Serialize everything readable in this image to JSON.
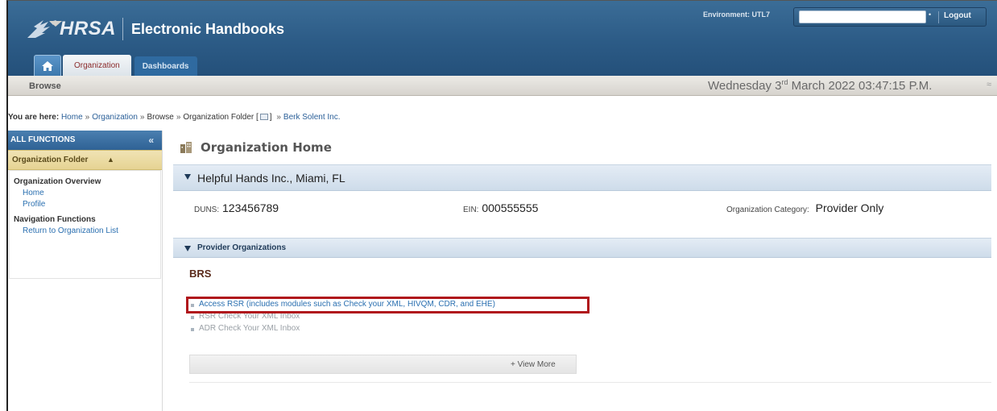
{
  "header": {
    "logo_text": "HRSA",
    "app_title": "Electronic Handbooks",
    "environment_label": "Environment: UTL7",
    "environment_dot": "•",
    "logout_label": "Logout",
    "brand_color": "#2c5b86"
  },
  "nav": {
    "home_icon": "home-icon",
    "tabs": [
      {
        "label": "Organization",
        "active": true
      },
      {
        "label": "Dashboards",
        "active": false
      }
    ]
  },
  "subnav": {
    "browse_label": "Browse",
    "date_weekday": "Wednesday 3",
    "date_suffix": "rd",
    "date_rest": " March 2022 03:47:15 P.M.",
    "collapse_glyph": "≈"
  },
  "breadcrumb": {
    "prefix": "You are here:",
    "items": [
      "Home",
      "Organization",
      "Browse",
      "Organization Folder [",
      "] ",
      "Berk Solent Inc."
    ],
    "separator": "»"
  },
  "sidebar": {
    "header": "ALL FUNCTIONS",
    "collapse_glyph": "«",
    "folder_label": "Organization Folder",
    "folder_caret": "▲",
    "groups": [
      {
        "title": "Organization Overview",
        "links": [
          "Home",
          "Profile"
        ]
      },
      {
        "title": "Navigation Functions",
        "links": [
          "Return to Organization List"
        ]
      }
    ]
  },
  "main": {
    "page_title": "Organization Home",
    "org_section_title": "Helpful Hands Inc., Miami, FL",
    "duns_label": "DUNS:",
    "duns_value": "123456789",
    "ein_label": "EIN:",
    "ein_value": "000555555",
    "category_label": "Organization Category:",
    "category_value": "Provider Only",
    "provider_section_title": "Provider Organizations",
    "brs_title": "BRS",
    "brs_items": [
      "Access RSR (includes modules such as Check your XML, HIVQM, CDR, and EHE)",
      "RSR Check Your XML Inbox",
      "ADR Check Your XML Inbox"
    ],
    "view_more_label": "+ View More",
    "highlight_color": "#b0161c"
  }
}
